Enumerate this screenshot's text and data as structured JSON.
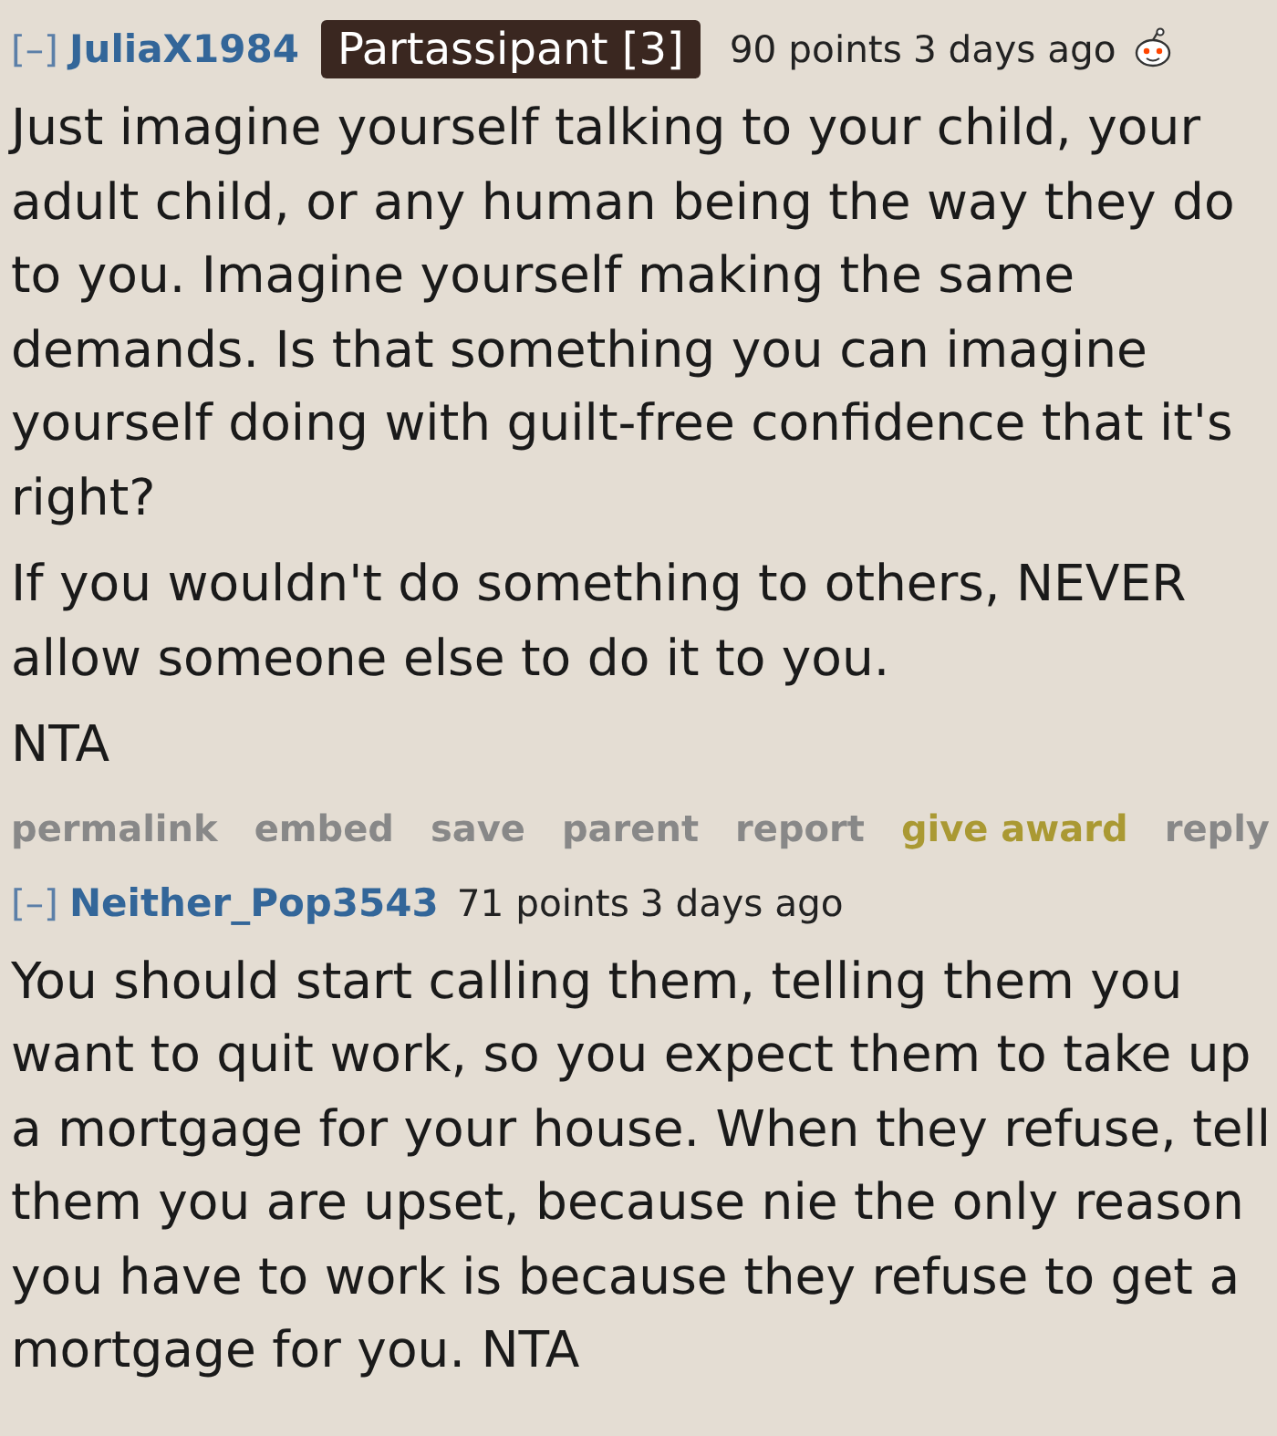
{
  "comments": [
    {
      "toggle": "[–]",
      "author": "JuliaX1984",
      "flair": "Partassipant [3]",
      "score": "90 points",
      "time": "3 days ago",
      "awarded": true,
      "paragraphs": [
        "Just imagine yourself talking to your child, your adult child, or any human being the way they do to you. Imagine yourself making the same demands. Is that something you can imagine yourself doing with guilt-free confidence that it's right?",
        "If you wouldn't do something to others, NEVER allow someone else to do it to you.",
        "NTA"
      ],
      "actions": [
        {
          "label": "permalink",
          "kind": "plain"
        },
        {
          "label": "embed",
          "kind": "plain"
        },
        {
          "label": "save",
          "kind": "plain"
        },
        {
          "label": "parent",
          "kind": "plain"
        },
        {
          "label": "report",
          "kind": "plain"
        },
        {
          "label": "give award",
          "kind": "award"
        },
        {
          "label": "reply",
          "kind": "plain"
        }
      ]
    },
    {
      "toggle": "[–]",
      "author": "Neither_Pop3543",
      "score": "71 points",
      "time": "3 days ago",
      "awarded": false,
      "paragraphs": [
        "You should start calling them, telling them you want to quit work, so you expect them to take up a mortgage for your house. When they refuse, tell them you are upset, because nie the only reason you have to work is because they refuse to get a mortgage for you. NTA"
      ]
    }
  ]
}
